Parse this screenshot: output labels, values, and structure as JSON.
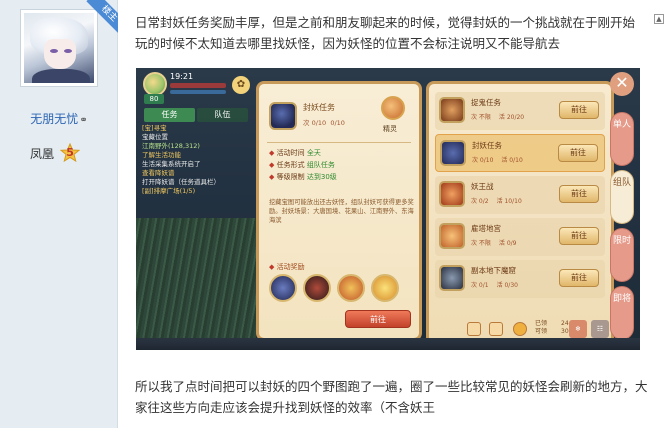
{
  "user": {
    "corner_badge": "楼主",
    "name": "无朋无忧",
    "title": "凤凰",
    "level": "5"
  },
  "post": {
    "text_top": "日常封妖任务奖励丰厚，但是之前和朋友聊起来的时候，觉得封妖的一个挑战就在于刚开始玩的时候不太知道去哪里找妖怪，因为妖怪的位置不会标注说明又不能导航去",
    "text_bottom": "所以我了点时间把可以封妖的四个野图跑了一遍，圈了一些比较常见的妖怪会刷新的地方，大家往这些方向走应该会提升找到妖怪的效率（不含妖王"
  },
  "game": {
    "hud": {
      "time": "19:21",
      "level": "80"
    },
    "side_tabs": [
      "任务",
      "队伍"
    ],
    "quests": [
      "[宝]寻宝",
      "宝藏位置",
      "江南野外(128,312)",
      "了解生活功能",
      "生活采集系统开启了",
      "查看降妖谱",
      "打开降妖谱（任务道具栏）",
      "[副]排摩广场(1/5)"
    ],
    "detail": {
      "name": "封妖任务",
      "count_label": "次",
      "count": "0/10",
      "count2": "0/10",
      "npc": "精灵",
      "time_label": "活动时间",
      "time_value": "全天",
      "form_label": "任务形式",
      "form_value": "组队任务",
      "level_label": "等级限制",
      "level_value": "达到30级",
      "desc": "挖藏宝图可能放出还古妖怪，组队封妖可获得更多奖励。封妖场景：大唐国境、花果山、江南野外、东海海滨",
      "reward_title": "活动奖励",
      "go_label": "前往"
    },
    "list": [
      {
        "name": "捉鬼任务",
        "sub1": "次 不限",
        "sub2": "活 20/20",
        "btn": "前往"
      },
      {
        "name": "封妖任务",
        "sub1": "次 0/10",
        "sub2": "活 0/10",
        "btn": "前往"
      },
      {
        "name": "妖王战",
        "sub1": "次 0/2",
        "sub2": "活 10/10",
        "btn": "前往"
      },
      {
        "name": "雇塔地宫",
        "sub1": "次 不限",
        "sub2": "活 0/9",
        "btn": "前往"
      },
      {
        "name": "副本地下魔窟",
        "sub1": "次 0/1",
        "sub2": "活 0/30",
        "btn": "前往"
      }
    ],
    "footer": {
      "got_label": "已领",
      "got": "24",
      "total_label": "可领",
      "total": "300"
    },
    "right_tabs": [
      "单人",
      "组队",
      "限时",
      "即将"
    ],
    "close": "✕"
  }
}
